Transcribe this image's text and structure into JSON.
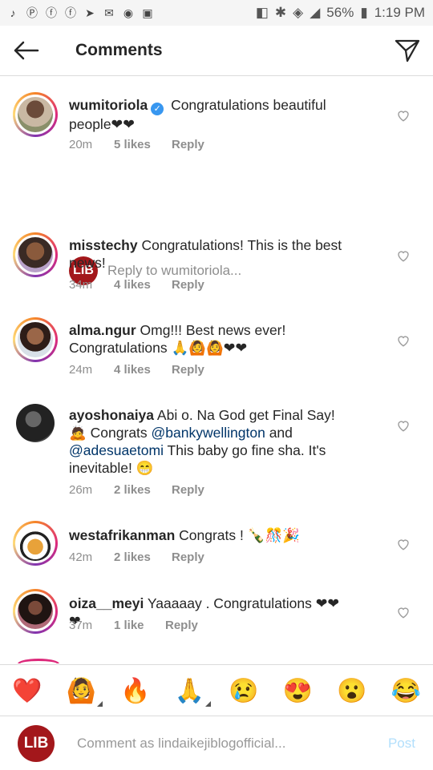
{
  "status": {
    "battery": "56%",
    "time": "1:19 PM",
    "left_icons": [
      "music-icon",
      "pinterest-icon",
      "facebook-icon",
      "facebook-icon",
      "telegram-icon",
      "gmail-icon",
      "messenger-icon",
      "image-icon"
    ]
  },
  "header": {
    "title": "Comments"
  },
  "comments": [
    {
      "username": "wumitoriola",
      "verified": true,
      "text": " Congratulations beautiful people❤❤",
      "time": "20m",
      "likes": "5 likes",
      "reply": "Reply"
    },
    {
      "username": "misstechy",
      "text": " Congratulations! This is the best news!",
      "time": "34m",
      "likes": "4 likes",
      "reply": "Reply"
    },
    {
      "username": "alma.ngur",
      "text": " Omg!!! Best news ever! Congratulations 🙏🙆🙆❤❤",
      "time": "24m",
      "likes": "4 likes",
      "reply": "Reply"
    },
    {
      "username": "ayoshonaiya",
      "text_pre": " Abi o. Na God get Final Say! 🙇 Congrats ",
      "mention1": "@bankywellington",
      "text_mid": " and ",
      "mention2": "@adesuaetomi",
      "text_post": " This baby go fine sha. It's inevitable! 😁",
      "time": "26m",
      "likes": "2 likes",
      "reply": "Reply"
    },
    {
      "username": "westafrikanman",
      "text": " Congrats ! 🍾🎊🎉",
      "time": "42m",
      "likes": "2 likes",
      "reply": "Reply"
    },
    {
      "username": "oiza__meyi",
      "text": " Yaaaaay . Congratulations ❤❤❤",
      "time": "37m",
      "likes": "1 like",
      "reply": "Reply"
    }
  ],
  "reply_prompt": "Reply to wumitoriola...",
  "reactions": [
    "❤️",
    "🙆",
    "🔥",
    "🙏",
    "😢",
    "😍",
    "😮",
    "😂"
  ],
  "composer": {
    "avatar_text": "LIB",
    "placeholder": "Comment as lindaikejiblogofficial...",
    "post_label": "Post"
  },
  "lib_label": "LIB",
  "colors": {
    "verified": "#3897f0",
    "mention": "#003569",
    "lib": "#a3171b",
    "post": "#b2dffc"
  }
}
